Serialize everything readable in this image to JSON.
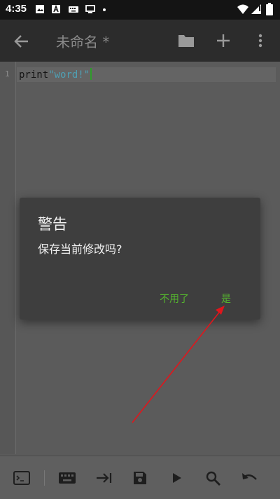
{
  "status_bar": {
    "time": "4:35",
    "left_icons": [
      "image-icon",
      "a-badge-icon",
      "keyboard-icon",
      "screen-icon",
      "dot-icon"
    ],
    "right_icons": [
      "wifi-icon",
      "cellular-icon",
      "battery-icon"
    ]
  },
  "app_bar": {
    "title": "未命名 *",
    "actions": [
      "back-arrow-icon",
      "folder-icon",
      "add-icon",
      "more-vert-icon"
    ]
  },
  "editor": {
    "line_number": "1",
    "code_keyword": "print",
    "code_string": "\"word!\""
  },
  "dialog": {
    "title": "警告",
    "message": "保存当前修改吗?",
    "negative_button": "不用了",
    "positive_button": "是",
    "button_color": "#55b62e"
  },
  "annotation": {
    "color": "#e0161c"
  },
  "toolbar": {
    "icons": [
      "terminal-icon",
      "keyboard-icon",
      "tab-icon",
      "save-icon",
      "run-icon",
      "search-icon",
      "undo-icon"
    ]
  }
}
